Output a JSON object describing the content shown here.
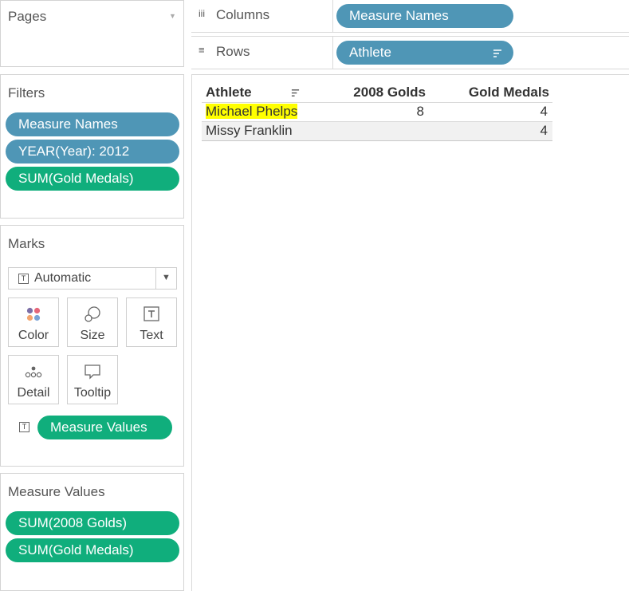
{
  "pages": {
    "title": "Pages"
  },
  "filters": {
    "title": "Filters",
    "items": [
      "Measure Names",
      "YEAR(Year): 2012",
      "SUM(Gold Medals)"
    ]
  },
  "marks": {
    "title": "Marks",
    "mark_type": "Automatic",
    "buttons": [
      "Color",
      "Size",
      "Text",
      "Detail",
      "Tooltip"
    ],
    "text_pill": "Measure Values"
  },
  "measure_values": {
    "title": "Measure Values",
    "items": [
      "SUM(2008 Golds)",
      "SUM(Gold Medals)"
    ]
  },
  "shelves": {
    "columns_label": "Columns",
    "columns_pill": "Measure Names",
    "rows_label": "Rows",
    "rows_pill": "Athlete"
  },
  "view": {
    "headers": [
      "Athlete",
      "2008 Golds",
      "Gold Medals"
    ],
    "rows": [
      {
        "athlete": "Michael Phelps",
        "golds_2008": "8",
        "gold_medals": "4"
      },
      {
        "athlete": "Missy Franklin",
        "golds_2008": "",
        "gold_medals": "4"
      }
    ]
  },
  "colors": {
    "dimension_pill": "#4f96b6",
    "measure_pill": "#10ae7c",
    "highlight": "#ffff00"
  }
}
